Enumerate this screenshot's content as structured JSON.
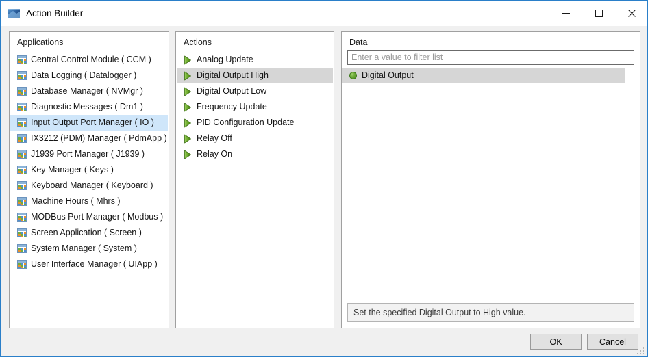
{
  "window": {
    "title": "Action Builder",
    "icon": "app-window-icon",
    "controls": {
      "minimize": "minimize-icon",
      "maximize": "maximize-icon",
      "close": "close-icon"
    },
    "accent_color": "#2a7fc9",
    "resize_grip": "resize-grip"
  },
  "applications_panel": {
    "label": "Applications",
    "selected_index": 4,
    "selection_color": "#cfe6fa",
    "items": [
      {
        "label": "Central Control Module  ( CCM )",
        "icon": "grid-icon"
      },
      {
        "label": "Data Logging  ( Datalogger )",
        "icon": "grid-icon"
      },
      {
        "label": "Database Manager  ( NVMgr )",
        "icon": "grid-icon"
      },
      {
        "label": "Diagnostic Messages  ( Dm1 )",
        "icon": "grid-icon"
      },
      {
        "label": "Input Output Port Manager  ( IO )",
        "icon": "grid-icon"
      },
      {
        "label": "IX3212 (PDM) Manager  ( PdmApp )",
        "icon": "grid-icon"
      },
      {
        "label": "J1939 Port Manager  ( J1939 )",
        "icon": "grid-icon"
      },
      {
        "label": "Key Manager  ( Keys )",
        "icon": "grid-icon"
      },
      {
        "label": "Keyboard Manager  ( Keyboard )",
        "icon": "grid-icon"
      },
      {
        "label": "Machine Hours  ( Mhrs )",
        "icon": "grid-icon"
      },
      {
        "label": "MODBus Port Manager  ( Modbus )",
        "icon": "grid-icon"
      },
      {
        "label": "Screen Application  ( Screen )",
        "icon": "grid-icon"
      },
      {
        "label": "System Manager  ( System )",
        "icon": "grid-icon"
      },
      {
        "label": "User Interface Manager  ( UIApp )",
        "icon": "grid-icon"
      }
    ]
  },
  "actions_panel": {
    "label": "Actions",
    "selected_index": 1,
    "selection_color": "#d6d6d6",
    "items": [
      {
        "label": "Analog Update",
        "icon": "play-triangle-icon"
      },
      {
        "label": "Digital Output High",
        "icon": "play-triangle-icon"
      },
      {
        "label": "Digital Output Low",
        "icon": "play-triangle-icon"
      },
      {
        "label": "Frequency Update",
        "icon": "play-triangle-icon"
      },
      {
        "label": "PID Configuration Update",
        "icon": "play-triangle-icon"
      },
      {
        "label": "Relay Off",
        "icon": "play-triangle-icon"
      },
      {
        "label": "Relay On",
        "icon": "play-triangle-icon"
      }
    ]
  },
  "data_panel": {
    "label": "Data",
    "filter": {
      "value": "",
      "placeholder": "Enter a value to filter list"
    },
    "selected_index": 0,
    "selection_color": "#d6d6d6",
    "items": [
      {
        "label": "Digital Output",
        "icon": "green-sphere-icon"
      }
    ],
    "description": "Set the specified Digital Output to High value."
  },
  "footer": {
    "ok_label": "OK",
    "cancel_label": "Cancel"
  }
}
